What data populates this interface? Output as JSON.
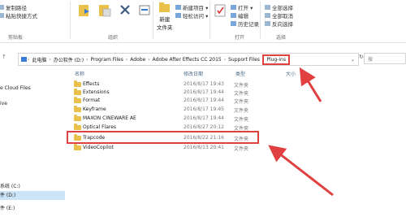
{
  "ribbon": {
    "col1": [
      "复制路径",
      "粘贴快捷方式"
    ],
    "col1_group": "剪贴板",
    "organize_group": "组织",
    "new_folder": [
      "新建",
      "文件夹"
    ],
    "new_items": [
      "新建项目 ▾",
      "轻松访问 ▾"
    ],
    "open_items": [
      "打开 ▾",
      "编辑",
      "历史记录"
    ],
    "open_group": "打开",
    "select_items": [
      "全部选择",
      "全部取消",
      "反向选择"
    ],
    "select_group": "选择"
  },
  "address": {
    "crumbs": [
      "此电脑",
      "办公软件 (D:)",
      "Program Files",
      "Adobe",
      "Adobe After Effects CC 2015",
      "Support Files",
      "Plug-ins"
    ],
    "search_placeholder": "搜"
  },
  "nav": {
    "top_items": [
      "e Cloud Files",
      "ive"
    ],
    "bottom_items": [
      "系统 (C:)",
      "件 (D:)",
      "件 (E:)"
    ]
  },
  "columns": {
    "name": "名称",
    "date": "修改日期",
    "type": "类型",
    "size": "大小"
  },
  "files": [
    {
      "name": "Effects",
      "date": "2016/8/17 19:43",
      "type": "文件夹"
    },
    {
      "name": "Extensions",
      "date": "2016/8/17 19:44",
      "type": "文件夹"
    },
    {
      "name": "Format",
      "date": "2016/8/17 19:44",
      "type": "文件夹"
    },
    {
      "name": "Keyframe",
      "date": "2016/8/17 19:45",
      "type": "文件夹"
    },
    {
      "name": "MAXON CINEWARE AE",
      "date": "2016/8/17 19:44",
      "type": "文件夹"
    },
    {
      "name": "Optical Flares",
      "date": "2016/8/27 20:12",
      "type": "文件夹"
    },
    {
      "name": "Trapcode",
      "date": "2016/8/22 21:16",
      "type": "文件夹"
    },
    {
      "name": "VideoCopilot",
      "date": "2016/8/13 20:41",
      "type": "文件夹"
    }
  ],
  "colors": {
    "highlight": "#e04040",
    "selected_nav": "#cce4f7",
    "folder": "#e8c04a"
  }
}
